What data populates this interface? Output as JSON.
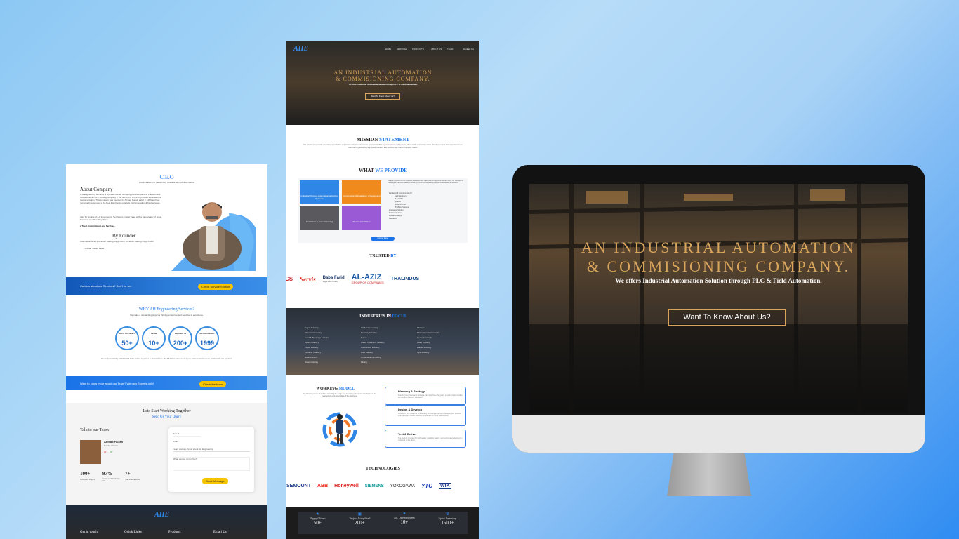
{
  "left_panel": {
    "ceo_title": "C.E.O",
    "ceo_sub": "Great Leadership Makes it All Possible with our affirmations",
    "about_title": "About Company",
    "about_p1": "A.H Engineering Services is a private owned company owned in Lahore, Pakistan and operates as an EPC working company in the sectors of Process, process automation & Instrumentation. This company was founded by Ahmad Sudais Latief in 1999 and has remarkably expanded to be Best Electronics supply & Instrumentation & field services.",
    "about_p2": "Also Sir Engine of A H Engineering Services is master rated with a wide variety of Great Services as a Reaching Team.",
    "about_p3": "a Trust, Commitment and Services.",
    "founder_title": "By Founder",
    "founder_quote": "Automation is not just about making things work, it's about making things better.",
    "founder_sign": "- Ahmad Sudais Latief",
    "banner1_text": "Curious about our Services? Don't be so..",
    "banner1_btn": "Check Service Section",
    "why_title": "WHY AH Engineering Services?",
    "why_sub": "We make a demanding project a thriving enterprise and we drive to excellence.",
    "stats": [
      {
        "label": "HAPPY CLIENTS",
        "value": "50+"
      },
      {
        "label": "TEAM",
        "value": "10+"
      },
      {
        "label": "PROJECTS",
        "value": "200+"
      },
      {
        "label": "ESTABLISHED",
        "value": "1999"
      }
    ],
    "why_note": "We are professionally staffed to fulfil all the various capacities as their business. The full deliver their success by our 24 hours Services team, And from the site operation.",
    "banner2_text": "Want to know more about our Team? We own Experts only!",
    "banner2_btn": "Check the team",
    "contact_title": "Lets Start Working Together",
    "contact_sub": "Send Us Your Query",
    "talk_title": "Talk to our Team",
    "member_name": "Ahmad Faizan",
    "member_role": "Founder / Director",
    "counts": [
      {
        "value": "100+",
        "label": "Successful Projects"
      },
      {
        "value": "97%",
        "label": "Customer Satisfaction rate"
      },
      {
        "value": "7+",
        "label": "Year of Experience"
      }
    ],
    "form_name": "Name*",
    "form_email": "Email*",
    "form_select": "I want discuss, Know about AH Engineering",
    "form_message": "What can we do for You?",
    "form_btn": "Send Message",
    "footer_logo": "AHE",
    "footer_links": [
      "Get in touch",
      "Quick Links",
      "Products",
      "Email Us"
    ]
  },
  "middle_panel": {
    "logo": "AHE",
    "nav": [
      "HOME",
      "SERVICES",
      "PRODUCTS",
      "ABOUT US",
      "TEAM"
    ],
    "nav_cta": "Contact Us",
    "hero_title_1": "AN INDUSTRIAL AUTOMATION",
    "hero_title_2": "& COMMISIONING COMPANY.",
    "hero_sub": "We offers Industrial Automation Solution through PLC & Field Automation.",
    "hero_btn": "Want To Know About Us?",
    "mission_a": "MISSION",
    "mission_b": "STATEMENT",
    "mission_text": "Our mission is to provide innovative and effective automation solutions that improve operational efficiency and increase safety for our clients in the automation sector. We strive to be a trusted partner for our customers by delivering high quality products and services that meet their specific needs.",
    "provide_a": "WHAT",
    "provide_b": "WE PROVIDE",
    "tiles": [
      {
        "label": "Industrial Process Automation & Control Systems",
        "color": "#2f86e6"
      },
      {
        "label": "Construction & Installation of Equipment",
        "color": "#f08a1c"
      },
      {
        "label": "Installation & Commissioning",
        "color": "#5a5a5e"
      },
      {
        "label": "Electric Installation",
        "color": "#9a5ad6"
      }
    ],
    "provide_intro": "We pride ourselves on our extensive experience and expertise in all aspects of Industrial work. We specialize in the design of industrial operations, ensuring that all the compatibility with our understanding of the latest technologies.",
    "provide_list": [
      "Installation & Commissioning Of",
      "Field Instruments",
      "PLC & HMI",
      "Systems",
      "AC Servo Drives",
      "VFD/Drive Systems",
      "Automation Solution",
      "Technical Services",
      "Detailed Drawings",
      "Calibration"
    ],
    "provide_btn": "Explore More",
    "trusted_a": "TRUSTED",
    "trusted_b": "BY",
    "trusted_logos": [
      "CS",
      "Servis",
      "Baba Farid",
      "AL-AZIZ",
      "THALINDUS"
    ],
    "trusted_sub_babafarid": "Sugar Mills Limited",
    "trusted_sub_alaziz": "GROUP OF COMPANIES",
    "industries_a": "INDUSTRIES IN",
    "industries_b": "FOCUS",
    "industries_col1": [
      "Sugar Industry",
      "Chemical Industry",
      "Food & Beverage Industry",
      "Textile Industry",
      "Paper Industry",
      "Fertilizer Industry",
      "Steel Industry",
      "Glass Industry"
    ],
    "industries_col2": [
      "Oil & Gas Industry",
      "Refinery Industry",
      "Power",
      "Water Treatment Industry",
      "Automotive Industry",
      "Auto Industry",
      "Construction Industry",
      "Mining"
    ],
    "industries_col3": [
      "Pharma",
      "Pharmaceutical Industry",
      "Cement Industry",
      "Dairy Industry",
      "Plastic Industry",
      "Tyre Industry"
    ],
    "working_a": "WORKING",
    "working_b": "MODEL",
    "working_text": "An elaborate process of methods to making the design and developing a functional item that meets the requirements and expectations of the customers.",
    "working_steps": [
      {
        "title": "Planning & Strategy",
        "text": "Planning the project and setting a plan to achieve the goals, ensuring best possible service and resource utilization."
      },
      {
        "title": "Design & Develop",
        "text": "Creation of the design of functionality, including equipment, designs, and product strategies, and create required innovations for more machineries."
      },
      {
        "title": "Test & Deliver",
        "text": "The product is tested for high quality, reliability, safety, and performance before it is delivered to the client."
      }
    ],
    "technologies_title": "TECHNOLOGIES",
    "tech_logos": [
      "SEMOUNT",
      "ABB",
      "Honeywell",
      "SIEMENS",
      "YOKOGAWA",
      "YTC",
      "WIK"
    ],
    "footer_stats": [
      {
        "label": "Happy Clients",
        "value": "50+"
      },
      {
        "label": "Project Completed",
        "value": "200+"
      },
      {
        "label": "No. Of Employees",
        "value": "10+"
      },
      {
        "label": "Spare Inventory",
        "value": "1500+"
      }
    ]
  },
  "monitor": {
    "hero_title_1": "AN INDUSTRIAL AUTOMATION",
    "hero_title_2": "& COMMISIONING COMPANY.",
    "hero_sub": "We offers Industrial Automation Solution through PLC & Field Automation.",
    "hero_btn": "Want To Know About Us?"
  },
  "colors": {
    "accent": "#1a73e8",
    "gold": "#d9a55c",
    "yellow": "#f7c500",
    "bg_gradient_end": "#2f8cf2"
  }
}
